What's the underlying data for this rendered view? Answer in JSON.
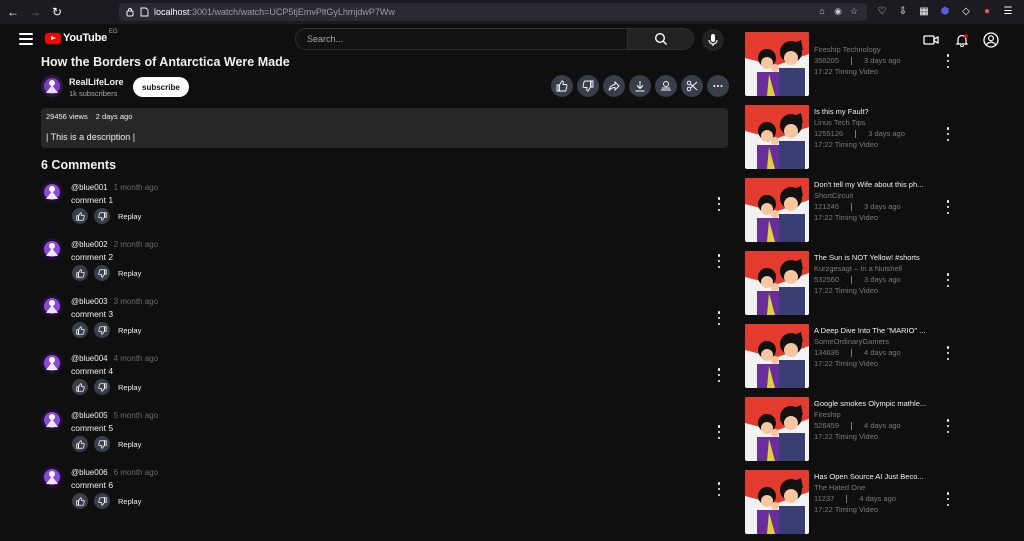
{
  "browser": {
    "url_host": "localhost",
    "url_path": ":3001/watch/watch=UCP5tjEmvPltGyLhmjdwP7Ww"
  },
  "header": {
    "logo_text": "YouTube",
    "logo_region": "EG",
    "search_placeholder": "Search...",
    "brand_red": "#ff0000"
  },
  "video": {
    "title": "How the Borders of Antarctica Were Made",
    "channel": "RealLifeLore",
    "subscribers": "1k subscribers",
    "subscribe_label": "subscribe",
    "views": "29456 views",
    "posted": "2 days ago",
    "description": "| This is a description |"
  },
  "comments": {
    "title": "6 Comments",
    "reply_label": "Replay",
    "items": [
      {
        "user": "@blue001",
        "time": "1 month ago",
        "text": "comment 1"
      },
      {
        "user": "@blue002",
        "time": "2 month ago",
        "text": "comment 2"
      },
      {
        "user": "@blue003",
        "time": "3 month ago",
        "text": "comment 3"
      },
      {
        "user": "@blue004",
        "time": "4 month ago",
        "text": "comment 4"
      },
      {
        "user": "@blue005",
        "time": "5 month ago",
        "text": "comment 5"
      },
      {
        "user": "@blue006",
        "time": "6 month ago",
        "text": "comment 6"
      }
    ]
  },
  "recommendations": [
    {
      "title": "",
      "channel": "Fireship Technology",
      "views": "356205",
      "age": "3 days ago",
      "duration": "17:22 Timing Video"
    },
    {
      "title": "Is this my Fault?",
      "channel": "Linus Tech Tips",
      "views": "1255126",
      "age": "3 days ago",
      "duration": "17:22 Timing Video"
    },
    {
      "title": "Don't tell my Wife about this ph...",
      "channel": "ShortCircuit",
      "views": "121246",
      "age": "3 days ago",
      "duration": "17:22 Timing Video"
    },
    {
      "title": "The Sun is NOT Yellow! #shorts",
      "channel": "Kurzgesagt – In a Nutshell",
      "views": "532560",
      "age": "3 days ago",
      "duration": "17:22 Timing Video"
    },
    {
      "title": "A Deep Dive Into The \"MARIO\" ...",
      "channel": "SomeOrdinaryGamers",
      "views": "134636",
      "age": "4 days ago",
      "duration": "17:22 Timing Video"
    },
    {
      "title": "Google smokes Olympic mathle...",
      "channel": "Fireship",
      "views": "526459",
      "age": "4 days ago",
      "duration": "17:22 Timing Video"
    },
    {
      "title": "Has Open Source AI Just Beco...",
      "channel": "The Hated One",
      "views": "11237",
      "age": "4 days ago",
      "duration": "17:22 Timing Video"
    }
  ]
}
